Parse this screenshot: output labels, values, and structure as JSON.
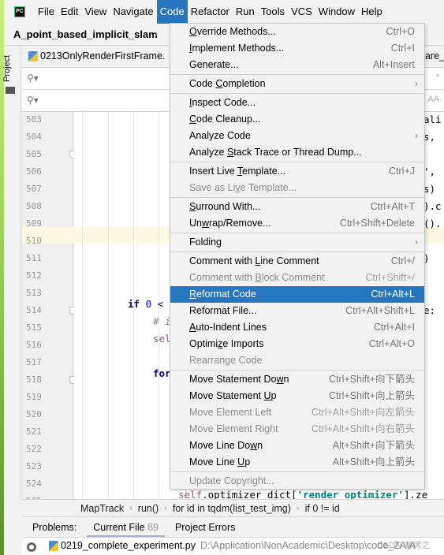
{
  "menubar": {
    "logo": "PC",
    "items": [
      "File",
      "Edit",
      "View",
      "Navigate",
      "Code",
      "Refactor",
      "Run",
      "Tools",
      "VCS",
      "Window",
      "Help"
    ],
    "active": "Code"
  },
  "navbar": {
    "project": "A_point_based_implicit_slam"
  },
  "sidebar": {
    "project_label": "Project"
  },
  "editor_tabs": {
    "current": "0213OnlyRenderFirstFrame.",
    "right_fragment": "are_e"
  },
  "search_rows": [
    {
      "icon": "search-icon",
      "extra": ".*"
    },
    {
      "icon": "search-icon",
      "extra": "A̲A"
    }
  ],
  "gutter": {
    "lines": [
      "503",
      "504",
      "505",
      "506",
      "507",
      "508",
      "509",
      "510",
      "511",
      "512",
      "513",
      "514",
      "515",
      "516",
      "517",
      "518",
      "519",
      "520",
      "521",
      "522",
      "523",
      "524",
      "525"
    ],
    "current_line": "510"
  },
  "code": {
    "right_fragments": [
      {
        "line": "503",
        "text": "ali"
      },
      {
        "line": "504",
        "text": "s, "
      },
      {
        "line": "506",
        "text": "', "
      },
      {
        "line": "507",
        "text": "s)"
      },
      {
        "line": "508",
        "text": ").c"
      },
      {
        "line": "509",
        "text": "()."
      },
      {
        "line": "511",
        "text": ")"
      },
      {
        "line": "514",
        "text": "e:"
      }
    ],
    "line_514": {
      "kw": "if",
      "num": "0",
      "op": "<"
    },
    "line_515": "# i",
    "line_516": "sel",
    "line_518": "for",
    "line_525": {
      "slf": "self",
      "rest": ".optimizer_dict[",
      "str": "'render_optimizer'",
      "end": "].ze"
    }
  },
  "code_menu": {
    "groups": [
      [
        {
          "label": "Override Methods...",
          "mnemonic": 0,
          "shortcut": "Ctrl+O"
        },
        {
          "label": "Implement Methods...",
          "mnemonic": 0,
          "shortcut": "Ctrl+I"
        },
        {
          "label": "Generate...",
          "shortcut": "Alt+Insert"
        }
      ],
      [
        {
          "label": "Code Completion",
          "mnemonic": 5,
          "submenu": true
        }
      ],
      [
        {
          "label": "Inspect Code...",
          "mnemonic": 0
        },
        {
          "label": "Code Cleanup...",
          "mnemonic": 0
        },
        {
          "label": "Analyze Code",
          "submenu": true
        },
        {
          "label": "Analyze Stack Trace or Thread Dump...",
          "mnemonic": 8
        }
      ],
      [
        {
          "label": "Insert Live Template...",
          "mnemonic": 12,
          "shortcut": "Ctrl+J"
        },
        {
          "label": "Save as Live Template...",
          "mnemonic": 10,
          "disabled": true
        }
      ],
      [
        {
          "label": "Surround With...",
          "mnemonic": 0,
          "shortcut": "Ctrl+Alt+T"
        },
        {
          "label": "Unwrap/Remove...",
          "mnemonic": 2,
          "shortcut": "Ctrl+Shift+Delete"
        }
      ],
      [
        {
          "label": "Folding",
          "submenu": true
        }
      ],
      [
        {
          "label": "Comment with Line Comment",
          "mnemonic": 13,
          "shortcut": "Ctrl+/"
        },
        {
          "label": "Comment with Block Comment",
          "mnemonic": 13,
          "shortcut": "Ctrl+Shift+/",
          "disabled": true
        },
        {
          "label": "Reformat Code",
          "mnemonic": 0,
          "shortcut": "Ctrl+Alt+L",
          "selected": true
        },
        {
          "label": "Reformat File...",
          "shortcut": "Ctrl+Alt+Shift+L"
        },
        {
          "label": "Auto-Indent Lines",
          "mnemonic": 0,
          "shortcut": "Ctrl+Alt+I"
        },
        {
          "label": "Optimize Imports",
          "mnemonic": 6,
          "shortcut": "Ctrl+Alt+O"
        },
        {
          "label": "Rearrange Code",
          "disabled": true
        }
      ],
      [
        {
          "label": "Move Statement Down",
          "mnemonic": 17,
          "shortcut": "Ctrl+Shift+向下箭头"
        },
        {
          "label": "Move Statement Up",
          "mnemonic": 15,
          "shortcut": "Ctrl+Shift+向上箭头"
        },
        {
          "label": "Move Element Left",
          "shortcut": "Ctrl+Alt+Shift+向左箭头",
          "disabled": true
        },
        {
          "label": "Move Element Right",
          "shortcut": "Ctrl+Alt+Shift+向右箭头",
          "disabled": true
        },
        {
          "label": "Move Line Down",
          "mnemonic": 12,
          "shortcut": "Alt+Shift+向下箭头"
        },
        {
          "label": "Move Line Up",
          "mnemonic": 10,
          "shortcut": "Alt+Shift+向上箭头"
        }
      ],
      [
        {
          "label": "Update Copyright...",
          "disabled": true
        }
      ]
    ]
  },
  "breadcrumb": [
    "MapTrack",
    "run()",
    "for id in tqdm(list_test_img)",
    "if 0 != id"
  ],
  "problems": {
    "label": "Problems:",
    "tabs": [
      {
        "label": "Current File",
        "count": "89",
        "active": true
      },
      {
        "label": "Project Errors"
      }
    ]
  },
  "problem_file": {
    "name": "0219_complete_experiment.py",
    "path": "D:\\Application\\NonAcademic\\Desktop\\code_ZA\\A"
  },
  "watermark": "CSDN @烤之"
}
